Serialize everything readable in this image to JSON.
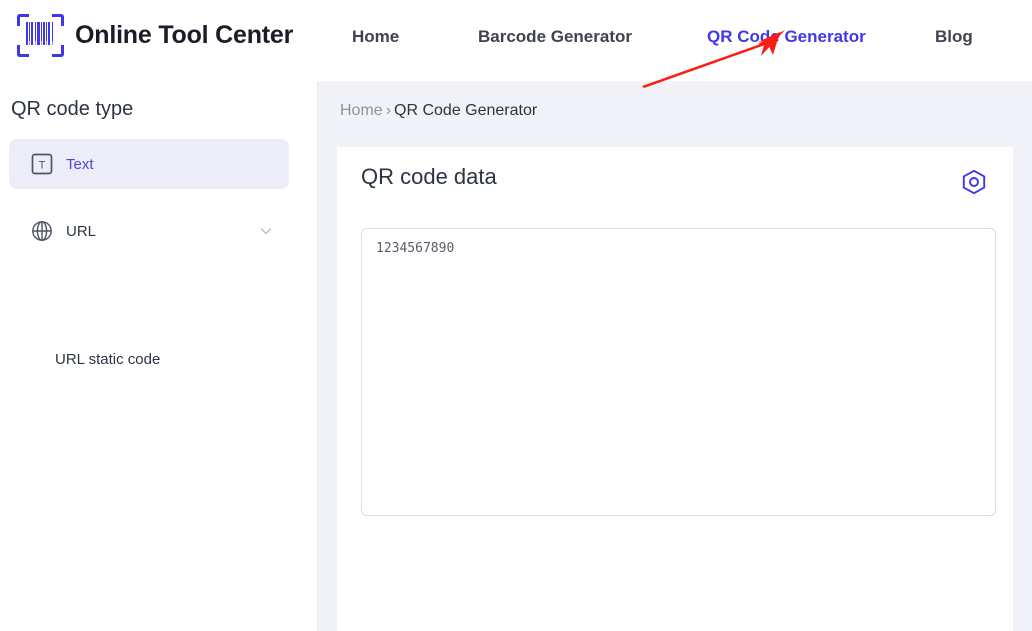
{
  "header": {
    "brand": {
      "name": "Online Tool Center",
      "logo_icon": "barcode-scan-icon",
      "logo_color": "#4038E8"
    },
    "nav": [
      {
        "label": "Home",
        "active": false
      },
      {
        "label": "Barcode Generator",
        "active": false
      },
      {
        "label": "QR Code Generator",
        "active": true
      },
      {
        "label": "Blog",
        "active": false
      }
    ],
    "active_color": "#4038E8",
    "inactive_color": "#3f4350"
  },
  "sidebar": {
    "title": "QR code type",
    "items": [
      {
        "label": "Text",
        "icon": "text-box-icon",
        "selected": true
      },
      {
        "label": "URL",
        "icon": "globe-icon",
        "selected": false,
        "expander_icon": "chevron-down-icon"
      }
    ],
    "sub_items": [
      {
        "label": "URL static code"
      }
    ],
    "selected_bg": "#EDEDFA",
    "selected_text_color": "#4A48D6"
  },
  "content": {
    "background": "#F2F3F8",
    "breadcrumb": {
      "home": "Home",
      "separator": "›",
      "current": "QR Code Generator"
    },
    "card": {
      "title": "QR code data",
      "settings_icon": "hexagon-target-icon",
      "settings_icon_color": "#4038E8",
      "textarea": {
        "value": "1234567890",
        "placeholder": ""
      }
    }
  },
  "annotation": {
    "type": "arrow",
    "color": "#FB1C12",
    "points_to": "QR Code Generator"
  }
}
